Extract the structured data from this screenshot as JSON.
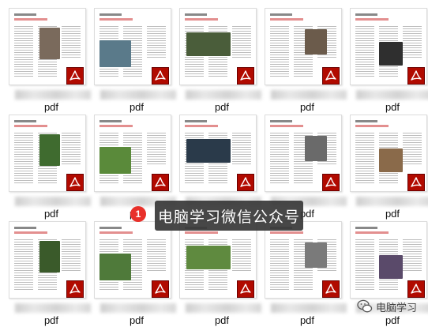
{
  "files": [
    {
      "ext": "pdf",
      "photo": "#7a6a5c"
    },
    {
      "ext": "pdf",
      "photo": "#5a7a8a"
    },
    {
      "ext": "pdf",
      "photo": "#4a5d3a"
    },
    {
      "ext": "pdf",
      "photo": "#6b5b4b"
    },
    {
      "ext": "pdf",
      "photo": "#2f2f2f"
    },
    {
      "ext": "pdf",
      "photo": "#3f6b2f"
    },
    {
      "ext": "pdf",
      "photo": "#5a8a3a"
    },
    {
      "ext": "pdf",
      "photo": "#2a3a4a"
    },
    {
      "ext": "pdf",
      "photo": "#6a6a6a"
    },
    {
      "ext": "pdf",
      "photo": "#8a6a4a"
    },
    {
      "ext": "pdf",
      "photo": "#3a5a2a"
    },
    {
      "ext": "pdf",
      "photo": "#4f7a3a"
    },
    {
      "ext": "pdf",
      "photo": "#5f8a3f"
    },
    {
      "ext": "pdf",
      "photo": "#7a7a7a"
    },
    {
      "ext": "pdf",
      "photo": "#5a4a6a"
    }
  ],
  "tooltip": {
    "step": "1",
    "text": "电脑学习微信公众号"
  },
  "watermark": {
    "text": "电脑学习",
    "icon": "wechat-icon"
  }
}
